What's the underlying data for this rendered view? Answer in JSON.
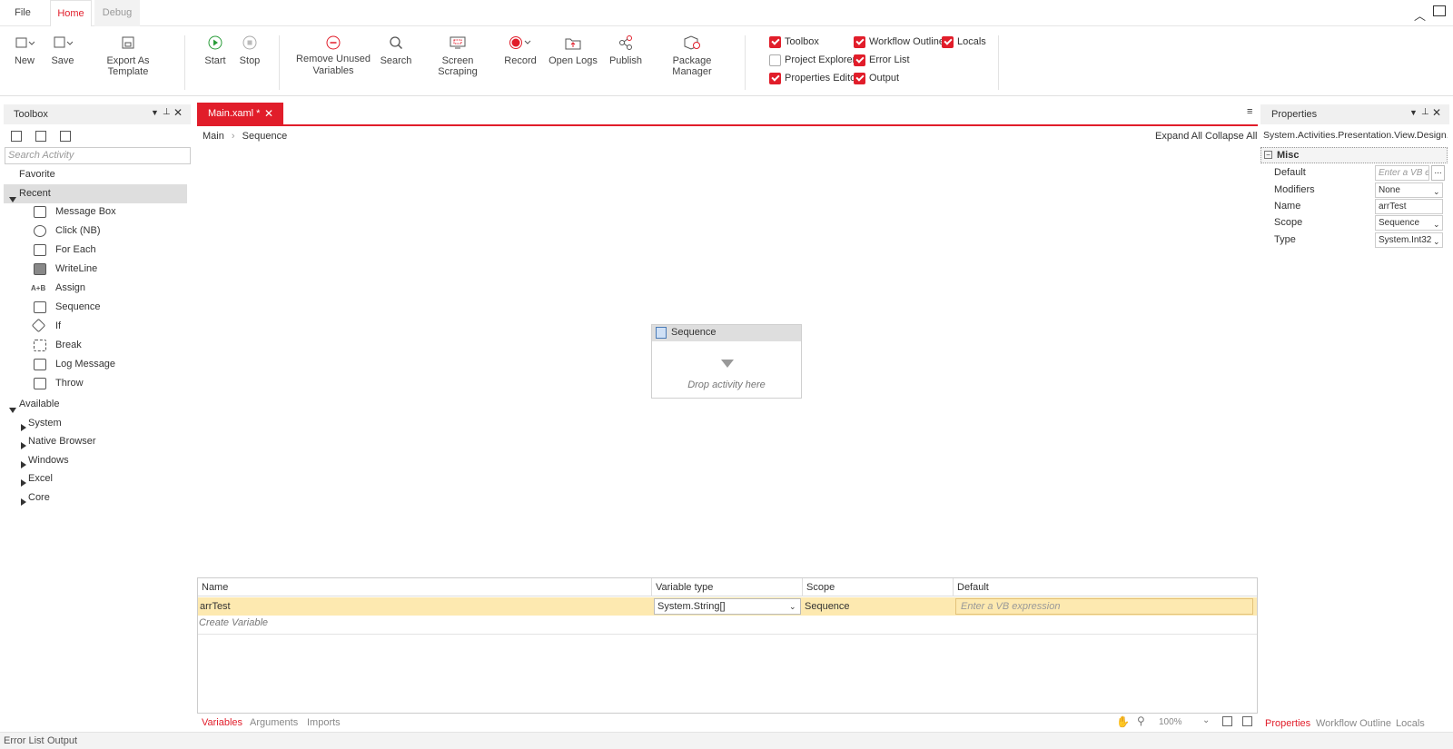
{
  "menubar": {
    "tabs": [
      {
        "label": "File"
      },
      {
        "label": "Home"
      },
      {
        "label": "Debug"
      }
    ]
  },
  "ribbon": {
    "buttons": [
      {
        "label": "New",
        "icon": "new-file-icon"
      },
      {
        "label": "Save",
        "icon": "save-icon"
      },
      {
        "label": "Export As Template",
        "icon": "export-template-icon"
      },
      {
        "label": "Start",
        "icon": "play-icon"
      },
      {
        "label": "Stop",
        "icon": "stop-icon"
      },
      {
        "label": "Remove Unused Variables",
        "icon": "remove-icon"
      },
      {
        "label": "Search",
        "icon": "search-icon"
      },
      {
        "label": "Screen Scraping",
        "icon": "screen-scraping-icon"
      },
      {
        "label": "Record",
        "icon": "record-icon"
      },
      {
        "label": "Open Logs",
        "icon": "open-logs-icon"
      },
      {
        "label": "Publish",
        "icon": "share-icon"
      },
      {
        "label": "Package Manager",
        "icon": "package-icon"
      }
    ],
    "checkboxes": [
      {
        "label": "Toolbox",
        "checked": true
      },
      {
        "label": "Workflow Outline",
        "checked": true
      },
      {
        "label": "Locals",
        "checked": true
      },
      {
        "label": "Project Explorer",
        "checked": false
      },
      {
        "label": "Error List",
        "checked": true
      },
      {
        "label": "Properties Editor",
        "checked": true
      },
      {
        "label": "Output",
        "checked": true
      }
    ]
  },
  "toolbox": {
    "title": "Toolbox",
    "search_placeholder": "Search Activity",
    "favorite": "Favorite",
    "recent": "Recent",
    "recent_items": [
      {
        "label": "Message Box"
      },
      {
        "label": "Click (NB)"
      },
      {
        "label": "For Each"
      },
      {
        "label": "WriteLine"
      },
      {
        "label": "Assign"
      },
      {
        "label": "Sequence"
      },
      {
        "label": "If"
      },
      {
        "label": "Break"
      },
      {
        "label": "Log Message"
      },
      {
        "label": "Throw"
      }
    ],
    "available": "Available",
    "available_items": [
      {
        "label": "System"
      },
      {
        "label": "Native Browser"
      },
      {
        "label": "Windows"
      },
      {
        "label": "Excel"
      },
      {
        "label": "Core"
      }
    ]
  },
  "designer": {
    "tab_label": "Main.xaml *",
    "breadcrumb": [
      "Main",
      "Sequence"
    ],
    "expand_all": "Expand All",
    "collapse_all": "Collapse All",
    "sequence_title": "Sequence",
    "drop_hint": "Drop activity here"
  },
  "variables": {
    "columns": [
      "Name",
      "Variable type",
      "Scope",
      "Default"
    ],
    "row": {
      "name": "arrTest",
      "type": "System.String[]",
      "scope": "Sequence",
      "default_placeholder": "Enter a VB expression"
    },
    "create": "Create Variable",
    "tabs": [
      "Variables",
      "Arguments",
      "Imports"
    ],
    "zoom": "100%"
  },
  "properties": {
    "title": "Properties",
    "class_name": "System.Activities.Presentation.View.Design...",
    "category": "Misc",
    "rows": [
      {
        "key": "Default",
        "value": "Enter a VB e"
      },
      {
        "key": "Modifiers",
        "value": "None"
      },
      {
        "key": "Name",
        "value": "arrTest"
      },
      {
        "key": "Scope",
        "value": "Sequence"
      },
      {
        "key": "Type",
        "value": "System.Int32"
      }
    ],
    "tabs": [
      "Properties",
      "Workflow Outline",
      "Locals"
    ]
  },
  "statusbar": {
    "tabs": [
      "Error List",
      "Output"
    ]
  },
  "colors": {
    "accent": "#e11d2a",
    "highlight_row": "#fde9b0"
  }
}
